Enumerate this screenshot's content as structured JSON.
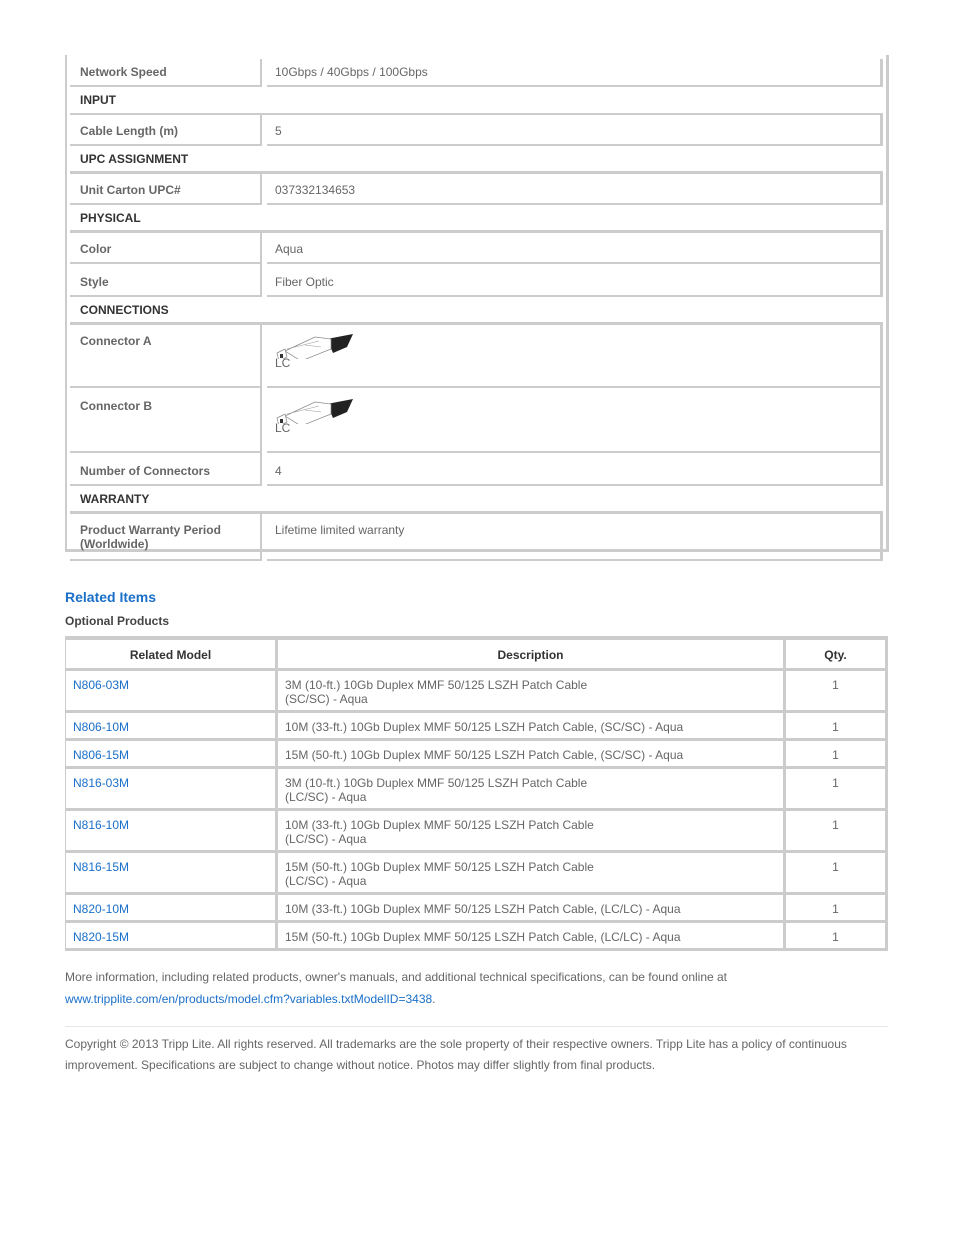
{
  "specs": {
    "network_speed": {
      "label": "Network Speed",
      "value": "10Gbps / 40Gbps / 100Gbps"
    },
    "sections": {
      "input": "INPUT",
      "upc": "UPC ASSIGNMENT",
      "physical": "PHYSICAL",
      "connections": "CONNECTIONS",
      "warranty": "WARRANTY"
    },
    "cable_length": {
      "label": "Cable Length (m)",
      "value": "5"
    },
    "upc": {
      "label": "Unit Carton UPC#",
      "value": "037332134653"
    },
    "color": {
      "label": "Color",
      "value": "Aqua"
    },
    "style": {
      "label": "Style",
      "value": "Fiber Optic"
    },
    "connector_a": {
      "label": "Connector A",
      "value": "LC",
      "icon": "lc-connector-icon"
    },
    "connector_b": {
      "label": "Connector B",
      "value": "LC",
      "icon": "lc-connector-icon"
    },
    "num_connectors": {
      "label": "Number of Connectors",
      "value": "4"
    },
    "warranty_period": {
      "label_line1": "Product Warranty Period",
      "label_line2": "(Worldwide)",
      "value": "Lifetime limited warranty"
    }
  },
  "related": {
    "title": "Related Items",
    "subtitle": "Optional Products",
    "headers": {
      "model": "Related Model",
      "description": "Description",
      "qty": "Qty."
    },
    "rows": [
      {
        "model": "N806-03M",
        "desc1": "3M (10-ft.) 10Gb Duplex MMF 50/125 LSZH Patch Cable",
        "desc2": "(SC/SC) - Aqua",
        "qty": "1"
      },
      {
        "model": "N806-10M",
        "desc1": "10M (33-ft.) 10Gb Duplex MMF 50/125 LSZH Patch Cable, (SC/SC) - Aqua",
        "desc2": "",
        "qty": "1"
      },
      {
        "model": "N806-15M",
        "desc1": "15M (50-ft.) 10Gb Duplex MMF 50/125 LSZH Patch Cable, (SC/SC) - Aqua",
        "desc2": "",
        "qty": "1"
      },
      {
        "model": "N816-03M",
        "desc1": "3M (10-ft.) 10Gb Duplex MMF 50/125 LSZH Patch Cable",
        "desc2": "(LC/SC) - Aqua",
        "qty": "1"
      },
      {
        "model": "N816-10M",
        "desc1": "10M (33-ft.) 10Gb Duplex MMF 50/125 LSZH Patch Cable",
        "desc2": "(LC/SC) - Aqua",
        "qty": "1"
      },
      {
        "model": "N816-15M",
        "desc1": "15M (50-ft.) 10Gb Duplex MMF 50/125 LSZH Patch Cable",
        "desc2": "(LC/SC) - Aqua",
        "qty": "1"
      },
      {
        "model": "N820-10M",
        "desc1": "10M (33-ft.) 10Gb Duplex MMF 50/125 LSZH Patch Cable, (LC/LC) - Aqua",
        "desc2": "",
        "qty": "1"
      },
      {
        "model": "N820-15M",
        "desc1": "15M (50-ft.) 10Gb Duplex MMF 50/125 LSZH Patch Cable, (LC/LC) - Aqua",
        "desc2": "",
        "qty": "1"
      }
    ]
  },
  "footer": {
    "more_info": "More information, including related products, owner's manuals, and additional technical specifications, can be found online at",
    "link": "www.tripplite.com/en/products/model.cfm?variables.txtModelID=3438",
    "link_suffix": ".",
    "copyright": "Copyright © 2013 Tripp Lite. All rights reserved. All trademarks are the sole property of their respective owners. Tripp Lite has a policy of continuous improvement. Specifications are subject to change without notice. Photos may differ slightly from final products."
  },
  "colors": {
    "link": "#1a6fc9",
    "border": "#cccccc",
    "text": "#666666"
  }
}
